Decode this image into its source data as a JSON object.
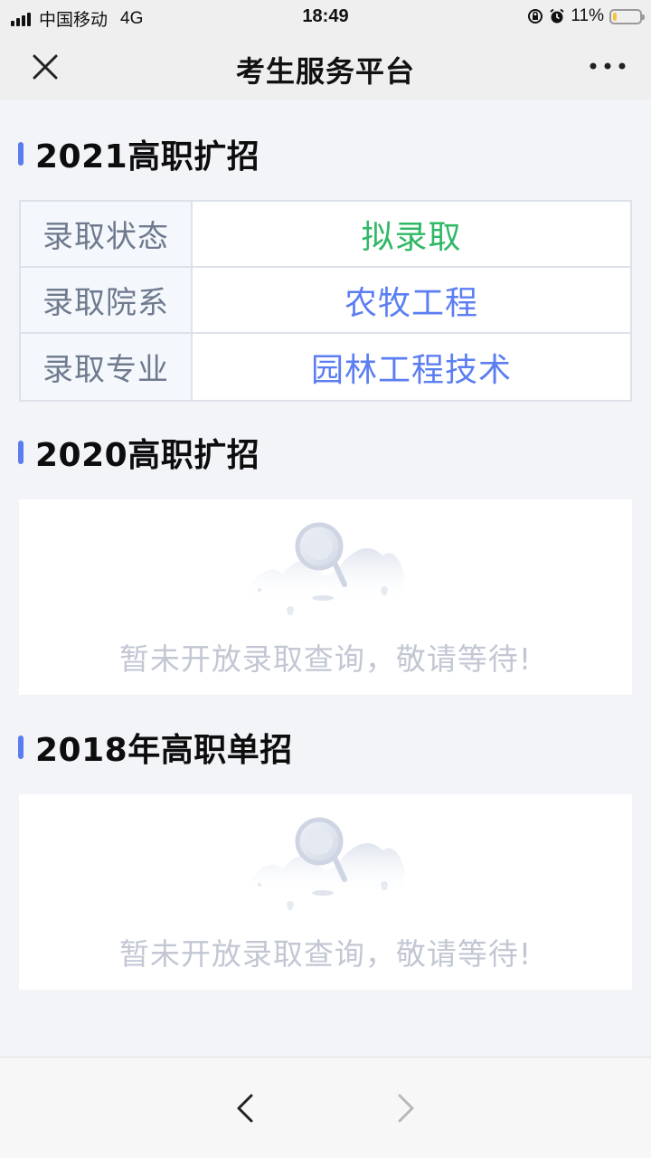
{
  "status_bar": {
    "carrier": "中国移动",
    "network": "4G",
    "time": "18:49",
    "battery_percent": "11%",
    "battery_level": 0.11,
    "icons": [
      "signal-icon",
      "orientation-lock-icon",
      "alarm-icon",
      "battery-icon"
    ]
  },
  "nav": {
    "title": "考生服务平台",
    "close_icon": "close-icon",
    "more_icon": "more-icon"
  },
  "sections": [
    {
      "title": "2021高职扩招",
      "rows": [
        {
          "label": "录取状态",
          "value": "拟录取",
          "value_color": "#2fb866"
        },
        {
          "label": "录取院系",
          "value": "农牧工程",
          "value_color": "#5b7ef2"
        },
        {
          "label": "录取专业",
          "value": "园林工程技术",
          "value_color": "#5b7ef2"
        }
      ]
    },
    {
      "title": "2020高职扩招",
      "empty_text": "暂未开放录取查询，敬请等待!",
      "empty_icon": "search-empty-illustration"
    },
    {
      "title": "2018年高职单招",
      "empty_text": "暂未开放录取查询，敬请等待!",
      "empty_icon": "search-empty-illustration"
    }
  ],
  "bottom_nav": {
    "back_icon": "chevron-left-icon",
    "forward_icon": "chevron-right-icon"
  },
  "colors": {
    "accent": "#5b7cf0",
    "success": "#2fb866",
    "link": "#5b7ef2",
    "label": "#6f7a8e",
    "empty_text": "#c2c7d3",
    "background": "#f2f4f8"
  }
}
